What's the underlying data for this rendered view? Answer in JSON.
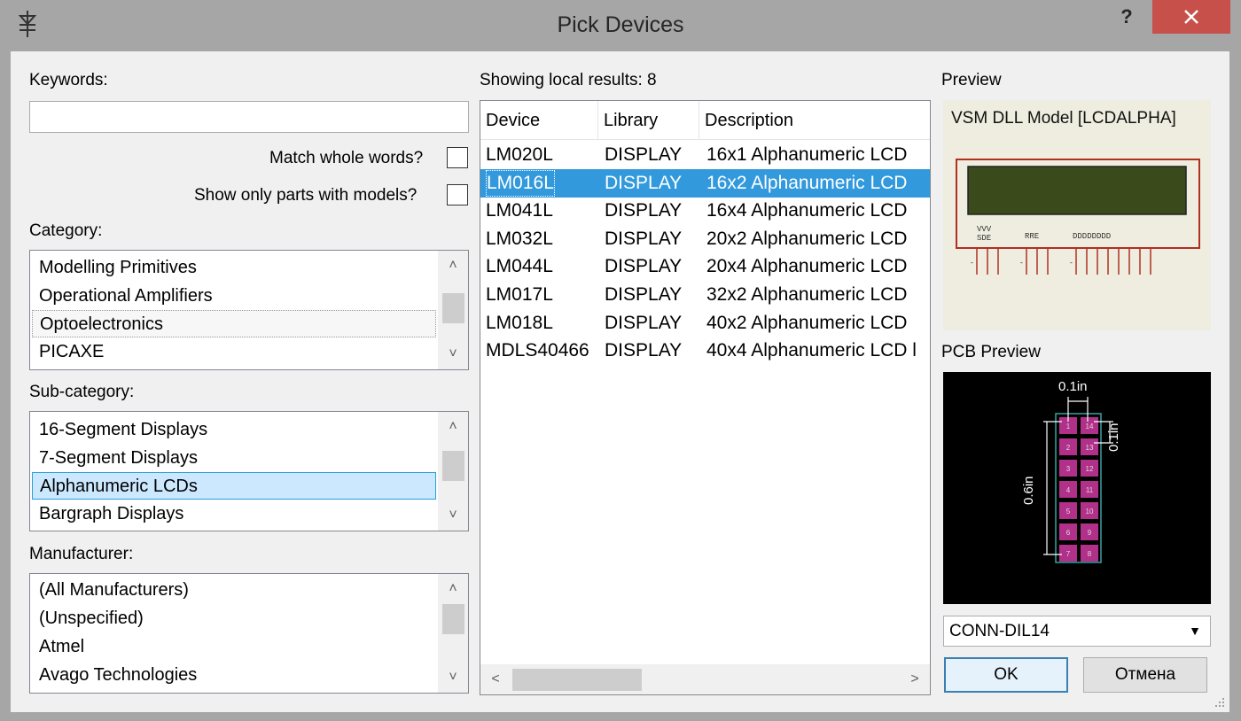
{
  "window": {
    "title": "Pick Devices",
    "help_label": "?"
  },
  "search": {
    "keywords_label": "Keywords:",
    "keywords_value": "",
    "match_whole_words_label": "Match whole words?",
    "show_only_models_label": "Show only parts with models?"
  },
  "category": {
    "label": "Category:",
    "items": [
      "Modelling Primitives",
      "Operational Amplifiers",
      "Optoelectronics",
      "PICAXE"
    ]
  },
  "subcategory": {
    "label": "Sub-category:",
    "items": [
      "16-Segment Displays",
      "7-Segment Displays",
      "Alphanumeric LCDs",
      "Bargraph Displays"
    ]
  },
  "manufacturer": {
    "label": "Manufacturer:",
    "items": [
      "(All Manufacturers)",
      "(Unspecified)",
      "Atmel",
      "Avago Technologies"
    ]
  },
  "results": {
    "summary": "Showing local results: 8",
    "columns": [
      "Device",
      "Library",
      "Description"
    ],
    "rows": [
      [
        "LM020L",
        "DISPLAY",
        "16x1 Alphanumeric LCD"
      ],
      [
        "LM016L",
        "DISPLAY",
        "16x2 Alphanumeric LCD"
      ],
      [
        "LM041L",
        "DISPLAY",
        "16x4 Alphanumeric LCD"
      ],
      [
        "LM032L",
        "DISPLAY",
        "20x2 Alphanumeric LCD"
      ],
      [
        "LM044L",
        "DISPLAY",
        "20x4 Alphanumeric LCD"
      ],
      [
        "LM017L",
        "DISPLAY",
        "32x2 Alphanumeric LCD"
      ],
      [
        "LM018L",
        "DISPLAY",
        "40x2 Alphanumeric LCD"
      ],
      [
        "MDLS40466",
        "DISPLAY",
        "40x4 Alphanumeric LCD l"
      ]
    ],
    "selected_row": 1
  },
  "preview": {
    "label": "Preview",
    "model_text": "VSM DLL Model [LCDALPHA]"
  },
  "pcb_preview": {
    "label": "PCB Preview",
    "dim_pitch_x": "0.1in",
    "dim_pitch_y": "0.1in",
    "dim_length": "0.6in",
    "pad_labels_left": [
      "1",
      "2",
      "3",
      "4",
      "5",
      "6",
      "7"
    ],
    "pad_labels_right": [
      "14",
      "13",
      "12",
      "11",
      "10",
      "9",
      "8"
    ]
  },
  "footprint": {
    "selected": "CONN-DIL14"
  },
  "buttons": {
    "ok": "OK",
    "cancel": "Отмена"
  },
  "colors": {
    "selection": "#3399dd",
    "list_selection": "#cce8ff",
    "close_button": "#c7504a",
    "pad": "#b0308a",
    "lcd_screen": "#3a4a1a",
    "component_outline": "#b03020"
  }
}
